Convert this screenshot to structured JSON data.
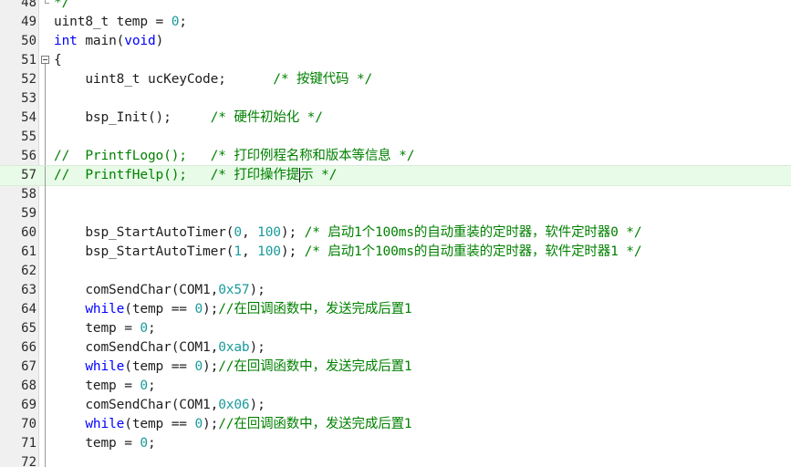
{
  "colors": {
    "keyword": "#0000ff",
    "number": "#1a9a9a",
    "comment": "#008000",
    "plain": "#1e1e1e",
    "current_line": "#e8fae8",
    "gutter": "#f0f0f0"
  },
  "editor": {
    "current_line": "57",
    "lines": [
      {
        "num": "48",
        "tokens": [
          {
            "t": "*/",
            "c": "com"
          }
        ]
      },
      {
        "num": "49",
        "tokens": [
          {
            "t": "uint8_t temp = ",
            "c": "plain"
          },
          {
            "t": "0",
            "c": "num"
          },
          {
            "t": ";",
            "c": "plain"
          }
        ]
      },
      {
        "num": "50",
        "tokens": [
          {
            "t": "int",
            "c": "kw"
          },
          {
            "t": " main(",
            "c": "plain"
          },
          {
            "t": "void",
            "c": "kw"
          },
          {
            "t": ")",
            "c": "plain"
          }
        ]
      },
      {
        "num": "51",
        "tokens": [
          {
            "t": "{",
            "c": "plain"
          }
        ]
      },
      {
        "num": "52",
        "tokens": [
          {
            "t": "    uint8_t ucKeyCode;      ",
            "c": "plain"
          },
          {
            "t": "/* 按键代码 */",
            "c": "com"
          }
        ]
      },
      {
        "num": "53",
        "tokens": []
      },
      {
        "num": "54",
        "tokens": [
          {
            "t": "    bsp_Init();     ",
            "c": "plain"
          },
          {
            "t": "/* 硬件初始化 */",
            "c": "com"
          }
        ]
      },
      {
        "num": "55",
        "tokens": []
      },
      {
        "num": "56",
        "tokens": [
          {
            "t": "//  PrintfLogo();   /* 打印例程名称和版本等信息 */",
            "c": "com"
          }
        ]
      },
      {
        "num": "57",
        "tokens": [
          {
            "t": "//  PrintfHelp();   /* 打印操作提",
            "c": "com"
          },
          {
            "t": "示 */",
            "c": "com"
          }
        ]
      },
      {
        "num": "58",
        "tokens": []
      },
      {
        "num": "59",
        "tokens": []
      },
      {
        "num": "60",
        "tokens": [
          {
            "t": "    bsp_StartAutoTimer(",
            "c": "plain"
          },
          {
            "t": "0",
            "c": "num"
          },
          {
            "t": ", ",
            "c": "plain"
          },
          {
            "t": "100",
            "c": "num"
          },
          {
            "t": "); ",
            "c": "plain"
          },
          {
            "t": "/* 启动1个100ms的自动重装的定时器，软件定时器0 */",
            "c": "com"
          }
        ]
      },
      {
        "num": "61",
        "tokens": [
          {
            "t": "    bsp_StartAutoTimer(",
            "c": "plain"
          },
          {
            "t": "1",
            "c": "num"
          },
          {
            "t": ", ",
            "c": "plain"
          },
          {
            "t": "100",
            "c": "num"
          },
          {
            "t": "); ",
            "c": "plain"
          },
          {
            "t": "/* 启动1个100ms的自动重装的定时器，软件定时器1 */",
            "c": "com"
          }
        ]
      },
      {
        "num": "62",
        "tokens": []
      },
      {
        "num": "63",
        "tokens": [
          {
            "t": "    comSendChar(COM1,",
            "c": "plain"
          },
          {
            "t": "0x57",
            "c": "num"
          },
          {
            "t": ");",
            "c": "plain"
          }
        ]
      },
      {
        "num": "64",
        "tokens": [
          {
            "t": "    ",
            "c": "plain"
          },
          {
            "t": "while",
            "c": "kw"
          },
          {
            "t": "(temp == ",
            "c": "plain"
          },
          {
            "t": "0",
            "c": "num"
          },
          {
            "t": ");",
            "c": "plain"
          },
          {
            "t": "//在回调函数中，发送完成后置1",
            "c": "com"
          }
        ]
      },
      {
        "num": "65",
        "tokens": [
          {
            "t": "    temp = ",
            "c": "plain"
          },
          {
            "t": "0",
            "c": "num"
          },
          {
            "t": ";",
            "c": "plain"
          }
        ]
      },
      {
        "num": "66",
        "tokens": [
          {
            "t": "    comSendChar(COM1,",
            "c": "plain"
          },
          {
            "t": "0xab",
            "c": "num"
          },
          {
            "t": ");",
            "c": "plain"
          }
        ]
      },
      {
        "num": "67",
        "tokens": [
          {
            "t": "    ",
            "c": "plain"
          },
          {
            "t": "while",
            "c": "kw"
          },
          {
            "t": "(temp == ",
            "c": "plain"
          },
          {
            "t": "0",
            "c": "num"
          },
          {
            "t": ");",
            "c": "plain"
          },
          {
            "t": "//在回调函数中，发送完成后置1",
            "c": "com"
          }
        ]
      },
      {
        "num": "68",
        "tokens": [
          {
            "t": "    temp = ",
            "c": "plain"
          },
          {
            "t": "0",
            "c": "num"
          },
          {
            "t": ";",
            "c": "plain"
          }
        ]
      },
      {
        "num": "69",
        "tokens": [
          {
            "t": "    comSendChar(COM1,",
            "c": "plain"
          },
          {
            "t": "0x06",
            "c": "num"
          },
          {
            "t": ");",
            "c": "plain"
          }
        ]
      },
      {
        "num": "70",
        "tokens": [
          {
            "t": "    ",
            "c": "plain"
          },
          {
            "t": "while",
            "c": "kw"
          },
          {
            "t": "(temp == ",
            "c": "plain"
          },
          {
            "t": "0",
            "c": "num"
          },
          {
            "t": ");",
            "c": "plain"
          },
          {
            "t": "//在回调函数中，发送完成后置1",
            "c": "com"
          }
        ]
      },
      {
        "num": "71",
        "tokens": [
          {
            "t": "    temp = ",
            "c": "plain"
          },
          {
            "t": "0",
            "c": "num"
          },
          {
            "t": ";",
            "c": "plain"
          }
        ]
      },
      {
        "num": "72",
        "tokens": []
      }
    ]
  }
}
